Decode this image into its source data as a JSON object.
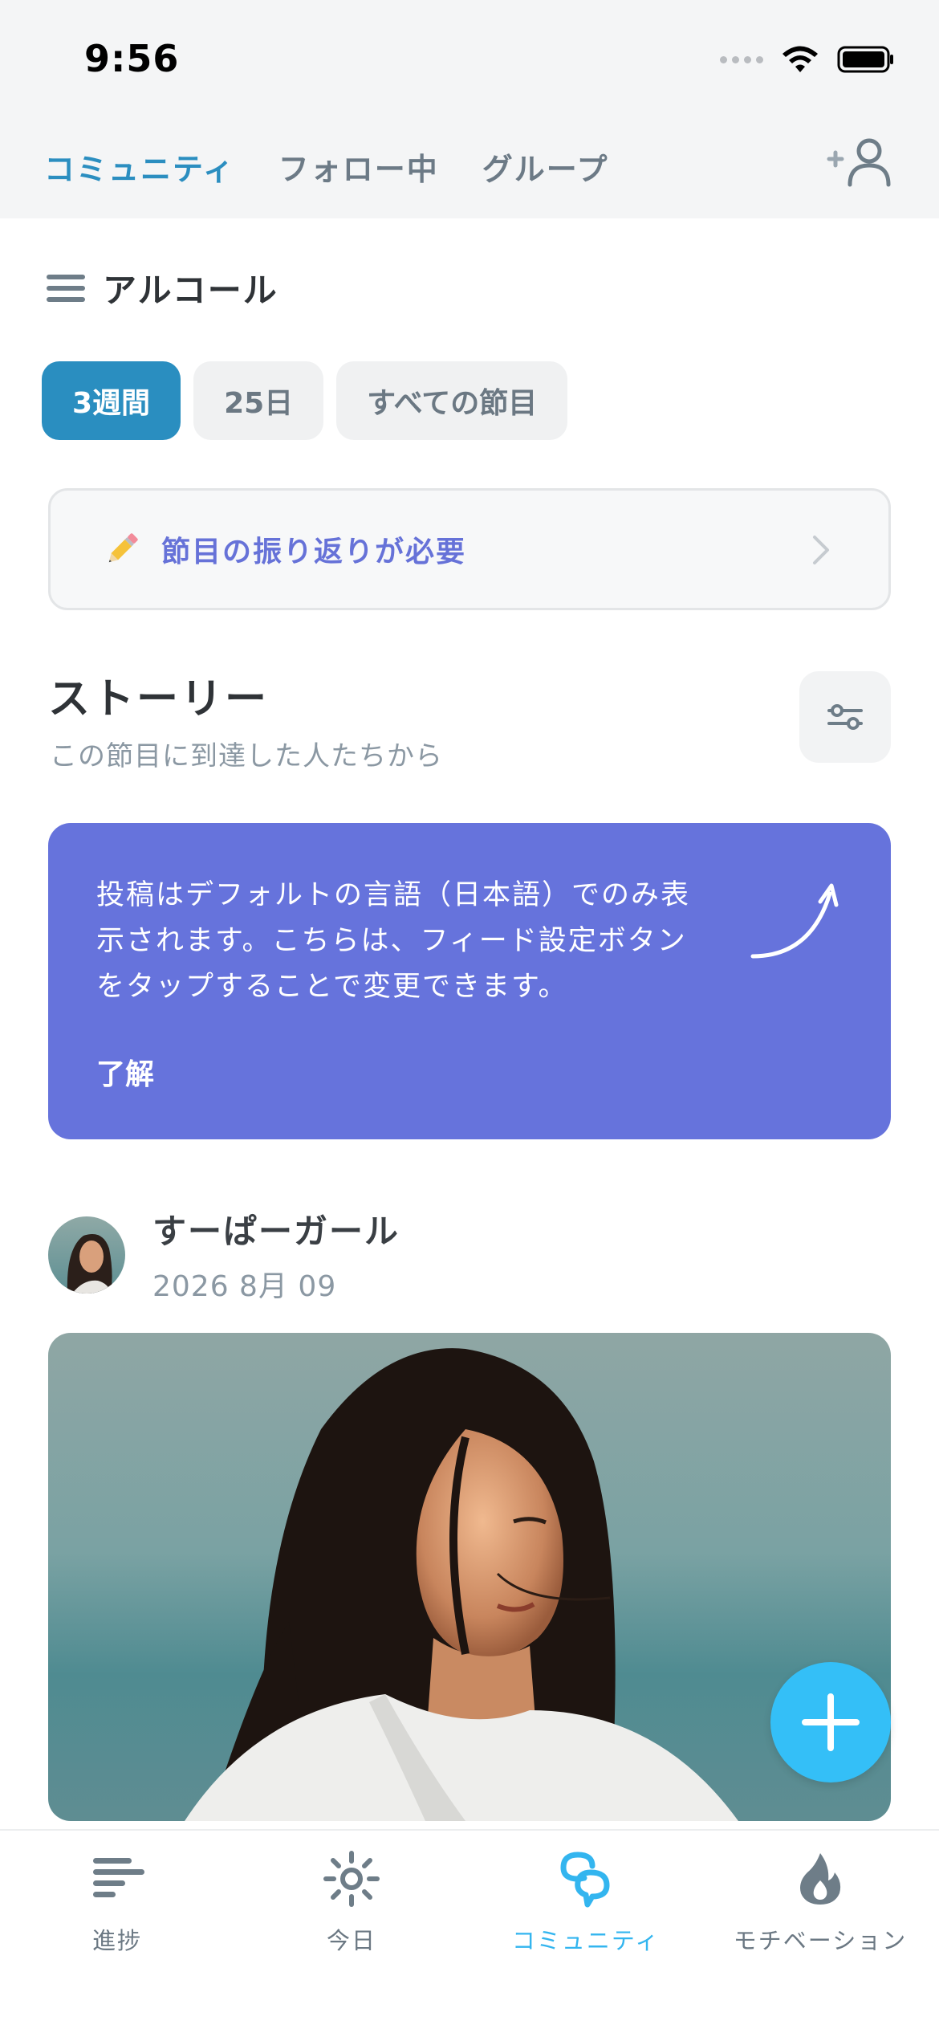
{
  "status_bar": {
    "time": "9:56"
  },
  "top_nav": {
    "tabs": [
      {
        "label": "コミュニティ",
        "active": true
      },
      {
        "label": "フォロー中",
        "active": false
      },
      {
        "label": "グループ",
        "active": false
      }
    ],
    "add_friend_icon": "add-person-icon"
  },
  "category": {
    "title": "アルコール",
    "icon": "hamburger-icon"
  },
  "chips": [
    {
      "label": "3週間",
      "active": true
    },
    {
      "label": "25日",
      "active": false
    },
    {
      "label": "すべての節目",
      "active": false
    }
  ],
  "review_card": {
    "icon": "pencil-icon",
    "text": "節目の振り返りが必要"
  },
  "stories": {
    "title": "ストーリー",
    "subtitle": "この節目に到達した人たちから",
    "filter_icon": "feed-settings-icon"
  },
  "info_card": {
    "text": "投稿はデフォルトの言語（日本語）でのみ表示されます。こちらは、フィード設定ボタンをタップすることで変更できます。",
    "ok_label": "了解"
  },
  "post": {
    "author": "すーぱーガール",
    "date": "2026 8月 09"
  },
  "bottom_nav": {
    "tabs": [
      {
        "label": "進捗",
        "icon": "progress-icon",
        "active": false
      },
      {
        "label": "今日",
        "icon": "sun-icon",
        "active": false
      },
      {
        "label": "コミュニティ",
        "icon": "community-icon",
        "active": true
      },
      {
        "label": "モチベーション",
        "icon": "flame-icon",
        "active": false
      }
    ]
  },
  "colors": {
    "accent_blue": "#2a8ec0",
    "info_card": "#6673dc",
    "fab": "#34bff7",
    "active_tab": "#33b5ef"
  }
}
